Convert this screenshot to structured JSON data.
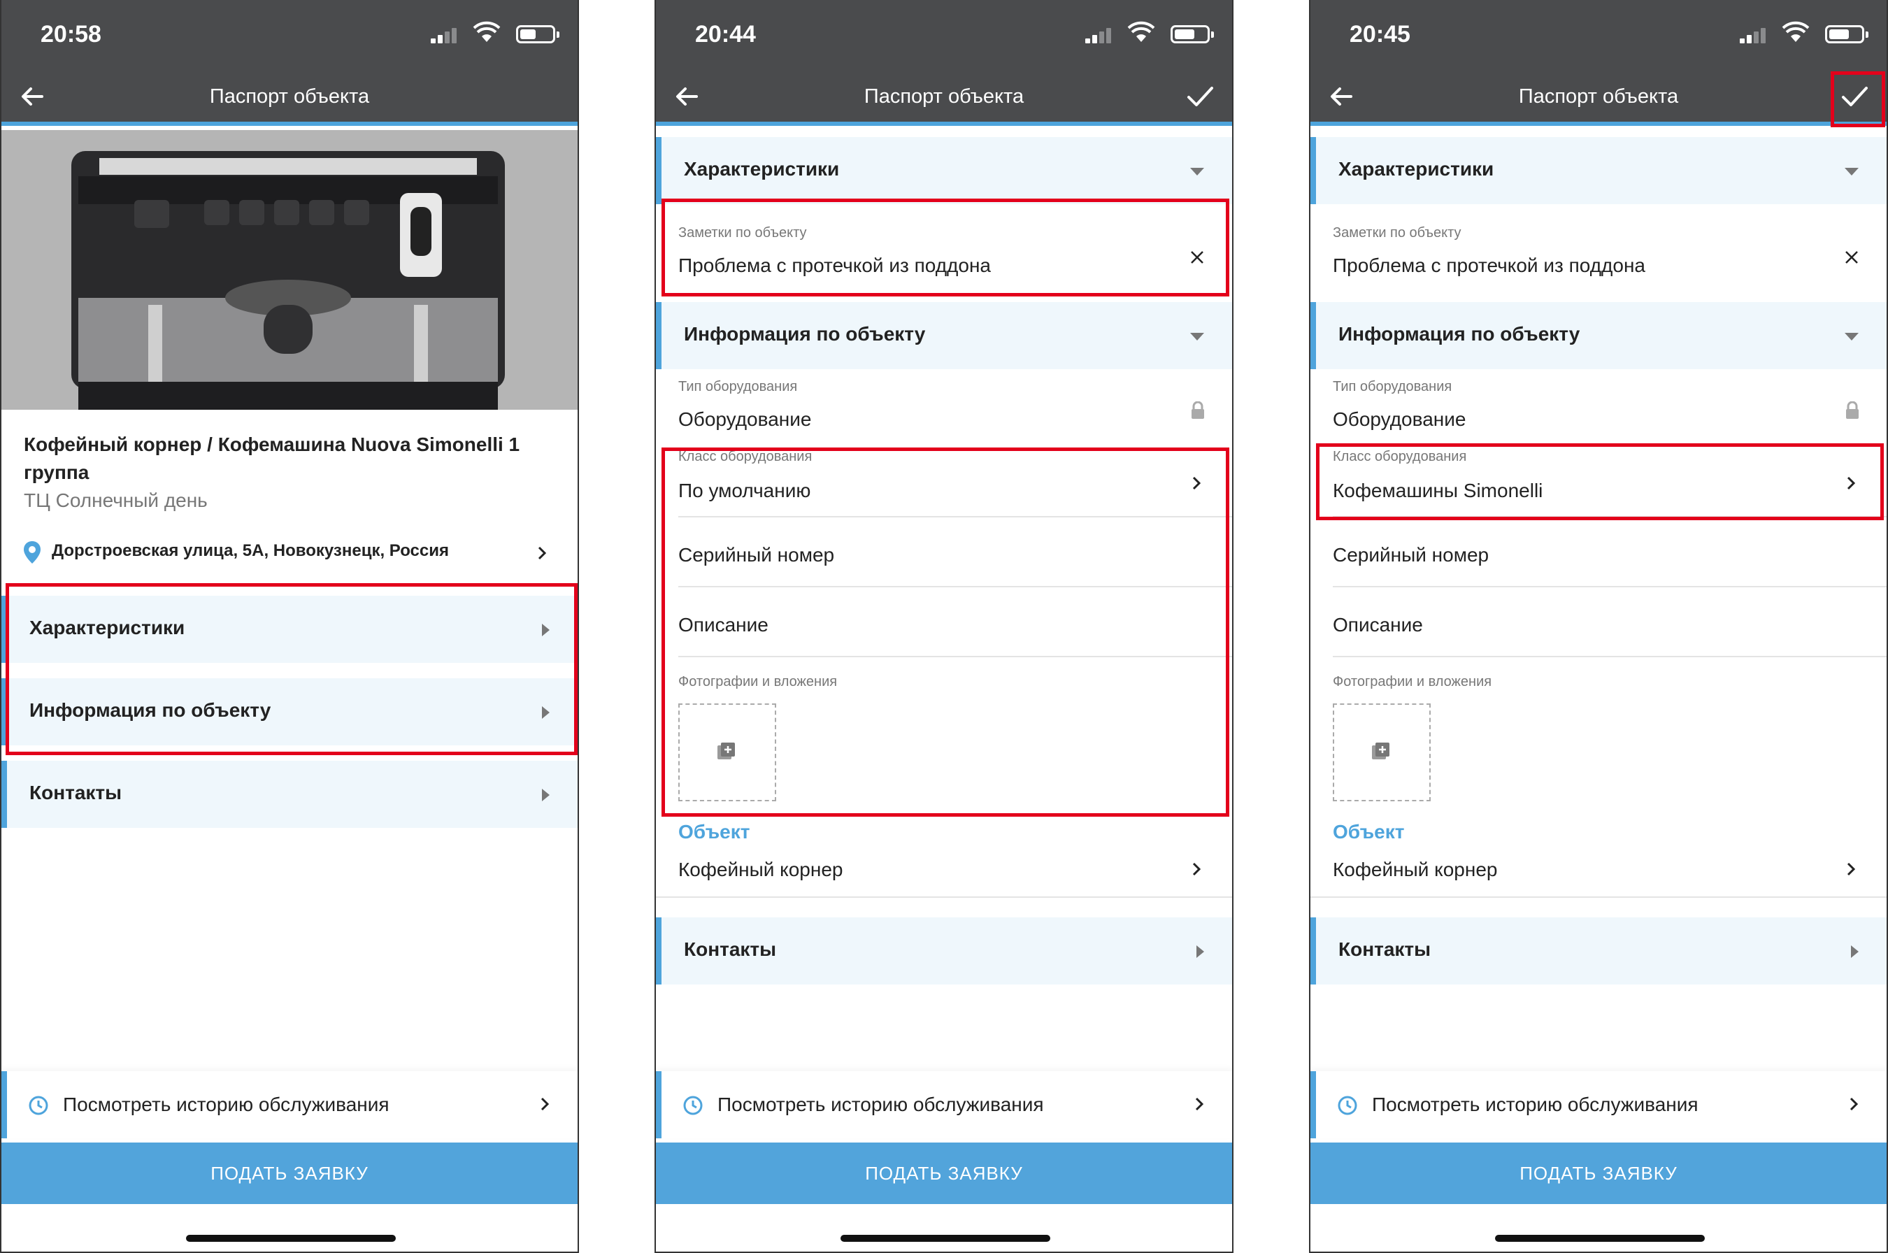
{
  "colors": {
    "accent": "#4ea4dc",
    "highlight": "#e3001b",
    "bar": "#4a4b4d",
    "section_bg": "#eff7fc",
    "button": "#52a4db"
  },
  "screens": [
    {
      "time": "20:58",
      "title": "Паспорт объекта",
      "object_title": "Кофейный корнер / Кофемашина Nuova Simonelli 1 группа",
      "object_subtitle": "ТЦ Солнечный день",
      "address": "Дорстроевская улица, 5А, Новокузнецк, Россия",
      "sections": [
        "Характеристики",
        "Информация по объекту",
        "Контакты"
      ],
      "history": "Посмотреть историю обслуживания",
      "submit": "ПОДАТЬ ЗАЯВКУ"
    },
    {
      "time": "20:44",
      "title": "Паспорт объекта",
      "characteristics": "Характеристики",
      "notes_label": "Заметки по объекту",
      "notes_value": "Проблема с протечкой из поддона",
      "info": "Информация по объекту",
      "equip_type_label": "Тип оборудования",
      "equip_type_value": "Оборудование",
      "equip_class_label": "Класс оборудования",
      "equip_class_value": "По умолчанию",
      "serial": "Серийный номер",
      "description": "Описание",
      "photos_label": "Фотографии и вложения",
      "object_label": "Объект",
      "object_value": "Кофейный корнер",
      "contacts": "Контакты",
      "history": "Посмотреть историю обслуживания",
      "submit": "ПОДАТЬ ЗАЯВКУ"
    },
    {
      "time": "20:45",
      "title": "Паспорт объекта",
      "characteristics": "Характеристики",
      "notes_label": "Заметки по объекту",
      "notes_value": "Проблема с протечкой из поддона",
      "info": "Информация по объекту",
      "equip_type_label": "Тип оборудования",
      "equip_type_value": "Оборудование",
      "equip_class_label": "Класс оборудования",
      "equip_class_value": "Кофемашины Simonelli",
      "serial": "Серийный номер",
      "description": "Описание",
      "photos_label": "Фотографии и вложения",
      "object_label": "Объект",
      "object_value": "Кофейный корнер",
      "contacts": "Контакты",
      "history": "Посмотреть историю обслуживания",
      "submit": "ПОДАТЬ ЗАЯВКУ"
    }
  ]
}
